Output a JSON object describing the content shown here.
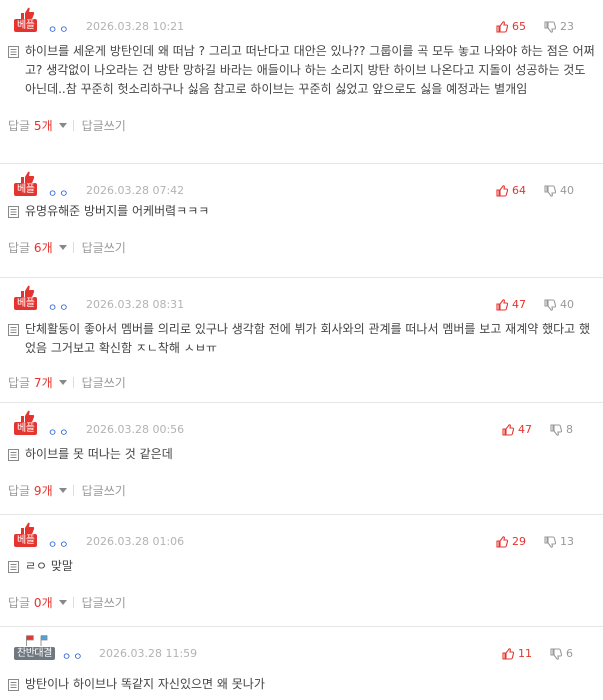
{
  "colors": {
    "accent_red": "#e3342f",
    "nick_blue": "#2b5fd9",
    "muted": "#b3b3b3",
    "badge_gray": "#6f7780"
  },
  "labels": {
    "reply_prefix": "답글",
    "reply_suffix": "개",
    "write_reply": "답글쓰기"
  },
  "comments": [
    {
      "badge": "베플",
      "nick": "ㅇㅇ",
      "date": "2026.03.28 10:21",
      "up": "65",
      "down": "23",
      "text": "하이브를 세운게 방탄인데 왜 떠남 ? 그리고 떠난다고 대안은 있나?? 그룹이를 곡 모두 놓고 나와야 하는 점은 어쩌고? 생각없이 나오라는 건 방탄 망하길 바라는 애들이나 하는 소리지 방탄 하이브 나온다고 지돌이 성공하는 것도 아닌데..참 꾸준히 헛소리하구나 싫음 참고로 하이브는 꾸준히 싫었고 앞으로도 싫을 예정과는 별개임",
      "replies": "5"
    },
    {
      "badge": "베플",
      "nick": "ㅇㅇ",
      "date": "2026.03.28 07:42",
      "up": "64",
      "down": "40",
      "text": "유명유해준 방버지를 어케버렼ㅋㅋㅋ",
      "replies": "6"
    },
    {
      "badge": "베플",
      "nick": "ㅇㅇ",
      "date": "2026.03.28 08:31",
      "up": "47",
      "down": "40",
      "text": "단체활동이 좋아서 멤버를 의리로 있구나 생각함 전에 뷔가 회사와의 관계를 떠나서 멤버를 보고 재계약 했다고 했었음 그거보고 확신함 ㅈㄴ착해 ㅅㅂㅠ",
      "replies": "7"
    },
    {
      "badge": "베플",
      "nick": "ㅇㅇ",
      "date": "2026.03.28 00:56",
      "up": "47",
      "down": "8",
      "text": "하이브를 못 떠나는 것 같은데",
      "replies": "9"
    },
    {
      "badge": "베플",
      "nick": "ㅇㅇ",
      "date": "2026.03.28 01:06",
      "up": "29",
      "down": "13",
      "text": "ㄹㅇ 맞말",
      "replies": "0"
    },
    {
      "badge": "찬반대결",
      "nick": "ㅇㅇ",
      "date": "2026.03.28 11:59",
      "up": "11",
      "down": "6",
      "text": "방탄이나 하이브나 똑같지 자신있으면 왜 못나가",
      "replies": ""
    }
  ]
}
